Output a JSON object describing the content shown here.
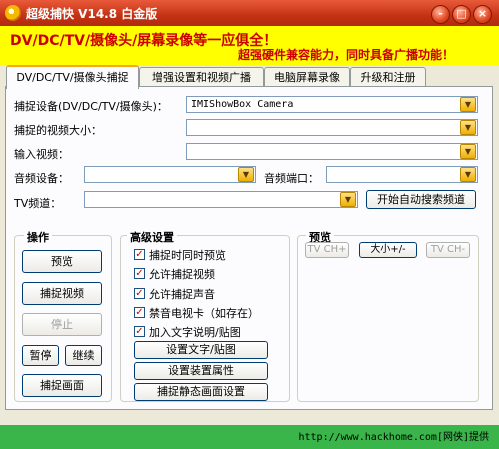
{
  "window": {
    "title": "超级捕快 V14.8 白金版",
    "controls": [
      "-",
      "□",
      "×"
    ]
  },
  "banner": {
    "line1": "DV/DC/TV/摄像头/屏幕录像等一应俱全！",
    "line2": "超强硬件兼容能力，同时具备广播功能！"
  },
  "tabs": [
    {
      "label": "DV/DC/TV/摄像头捕捉",
      "active": true
    },
    {
      "label": "增强设置和视频广播"
    },
    {
      "label": "电脑屏幕录像"
    },
    {
      "label": "升级和注册"
    }
  ],
  "form": {
    "device_label": "捕捉设备(DV/DC/TV/摄像头)：",
    "device_value": "IMIShowBox Camera",
    "size_label": "捕捉的视频大小：",
    "size_value": "",
    "input_label": "输入视频：",
    "input_value": "",
    "audio_label": "音频设备：",
    "audio_value": "",
    "audio_port_label": "音频端口：",
    "audio_port_value": "",
    "tv_label": "TV频道：",
    "tv_value": "",
    "auto_search_label": "开始自动搜索频道"
  },
  "operations": {
    "title": "操作",
    "preview": "预览",
    "capture_video": "捕捉视频",
    "stop": "停止",
    "pause": "暂停",
    "resume": "继续",
    "capture_frame": "捕捉画面"
  },
  "advanced": {
    "title": "高级设置",
    "options": [
      {
        "label": "捕捉时同时预览",
        "checked": true
      },
      {
        "label": "允许捕捉视频",
        "checked": true
      },
      {
        "label": "允许捕捉声音",
        "checked": true
      },
      {
        "label": "禁音电视卡（如存在）",
        "checked": true
      },
      {
        "label": "加入文字说明/贴图",
        "checked": true
      }
    ],
    "set_text": "设置文字/贴图",
    "set_device": "设置装置属性",
    "set_still": "捕捉静态画面设置"
  },
  "preview": {
    "title": "预览",
    "tv_ch_minus": "TV CH+",
    "size_button": "大小+/-",
    "tv_ch_plus": "TV CH-"
  },
  "status_bar": {
    "text": "http://www.hackhome.com[网侠]提供"
  },
  "colors": {
    "title_bar": "#c43214",
    "banner_bg": "#ffff00",
    "banner_text": "#cc0000",
    "status_bg": "#39b54a",
    "tab_accent": "#f5a624"
  }
}
